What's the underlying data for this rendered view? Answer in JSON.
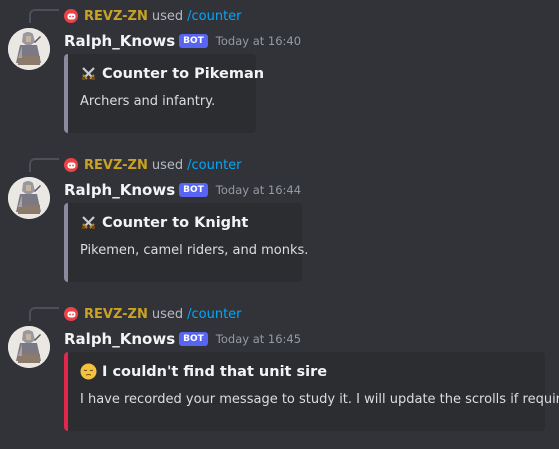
{
  "messages": [
    {
      "reference": {
        "user": "REVZ-ZN",
        "used": "used",
        "command": "/counter"
      },
      "author": "Ralph_Knows",
      "bot_tag": "BOT",
      "timestamp": "Today at 16:40",
      "embed": {
        "icon": "crossed-swords-icon",
        "title": "Counter to Pikeman",
        "description": "Archers and infantry."
      }
    },
    {
      "reference": {
        "user": "REVZ-ZN",
        "used": "used",
        "command": "/counter"
      },
      "author": "Ralph_Knows",
      "bot_tag": "BOT",
      "timestamp": "Today at 16:44",
      "embed": {
        "icon": "crossed-swords-icon",
        "title": "Counter to Knight",
        "description": "Pikemen, camel riders, and monks."
      }
    },
    {
      "reference": {
        "user": "REVZ-ZN",
        "used": "used",
        "command": "/counter"
      },
      "author": "Ralph_Knows",
      "bot_tag": "BOT",
      "timestamp": "Today at 16:45",
      "embed": {
        "icon": "pensive-face-icon",
        "title": "I couldn't find that unit sire",
        "description": "I have recorded your message to study it. I will update the scrolls if required."
      }
    }
  ],
  "colors": {
    "background": "#313338",
    "embed_background": "#2b2d31",
    "embed_border_default": "#8b8ba0",
    "embed_border_error": "#e0284c",
    "bot_tag": "#5865f2",
    "reference_user": "#c9a227",
    "command": "#00a8fc"
  }
}
